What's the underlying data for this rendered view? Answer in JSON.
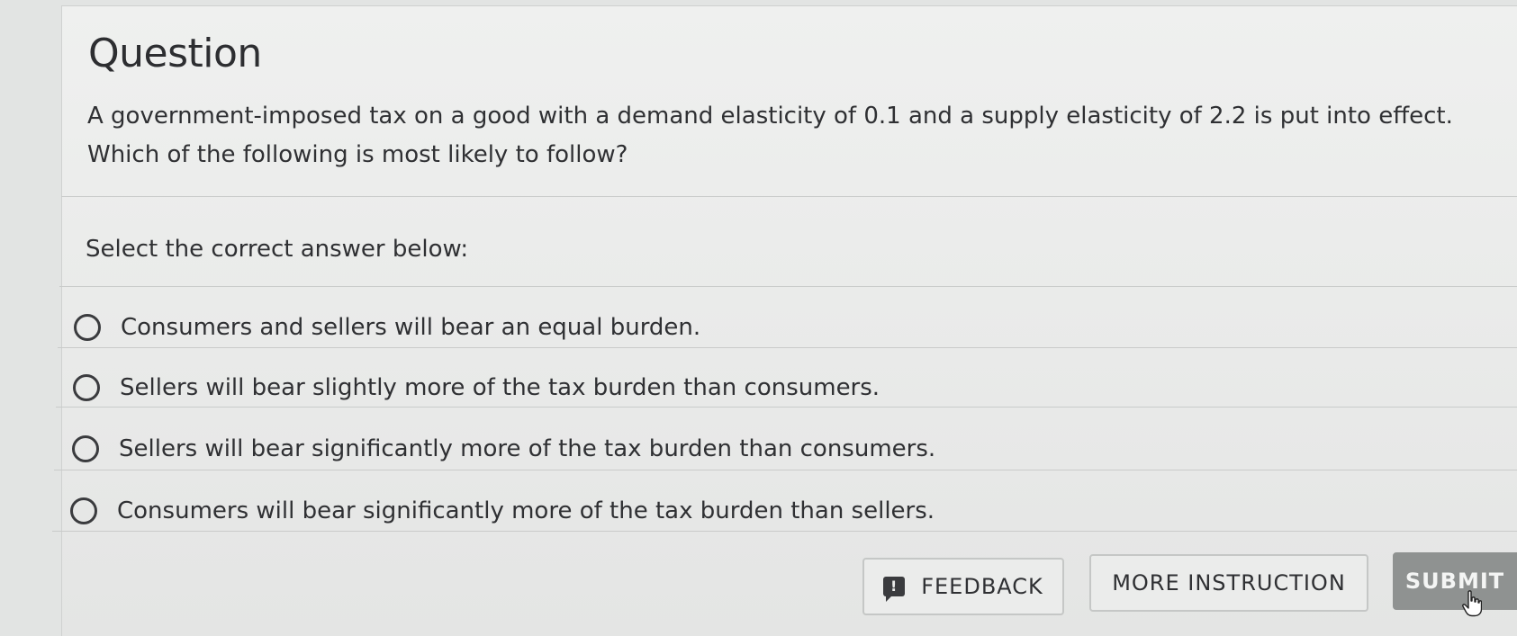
{
  "question": {
    "title": "Question",
    "prompt": "A government-imposed tax on a good with a demand elasticity of 0.1 and a supply elasticity of 2.2 is put into effect. Which of the following is most likely to follow?",
    "instruction": "Select the correct answer below:"
  },
  "options": [
    {
      "label": "Consumers and sellers will bear an equal burden.",
      "selected": false
    },
    {
      "label": "Sellers will bear slightly more of the tax burden than consumers.",
      "selected": false
    },
    {
      "label": "Sellers will bear significantly more of the tax burden than consumers.",
      "selected": false
    },
    {
      "label": "Consumers will bear significantly more of the tax burden than sellers.",
      "selected": false
    }
  ],
  "actions": {
    "feedback_label": "FEEDBACK",
    "feedback_icon": "!",
    "more_instruction_label": "MORE INSTRUCTION",
    "submit_label": "SUBMIT"
  },
  "colors": {
    "background": "#e2e4e3",
    "card": "#eff0ef",
    "text": "#2f3033",
    "submit_bg": "#8f9291"
  },
  "icons": {
    "feedback": "feedback-alert-icon",
    "radio": "radio-unchecked-icon",
    "cursor": "hand-pointer-icon"
  }
}
